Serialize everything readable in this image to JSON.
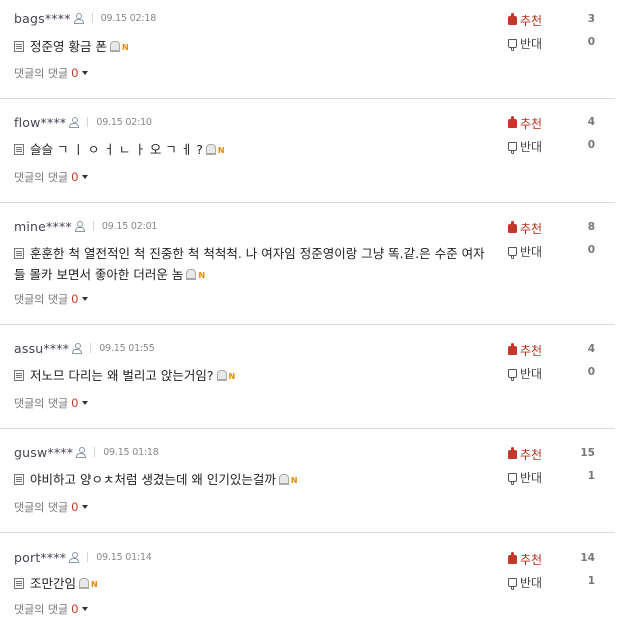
{
  "labels": {
    "reply_of_reply": "댓글의 댓글",
    "recommend": "추천",
    "oppose": "반대"
  },
  "comments": [
    {
      "author": "bags****",
      "time": "09.15 02:18",
      "text": "정준영 황금 폰",
      "replies": "0",
      "up": "3",
      "down": "0"
    },
    {
      "author": "flow****",
      "time": "09.15 02:10",
      "text": "슬슬 ㄱ ㅣ ㅇ ㅓ ㄴ ㅏ 오 ㄱ ㅔ ?",
      "replies": "0",
      "up": "4",
      "down": "0"
    },
    {
      "author": "mine****",
      "time": "09.15 02:01",
      "text": "훈훈한 척 열전적인 척 진중한 척 척척척. 나 여자임 정준영이랑 그냥 똑.같.은 수준 여자들 몰카 보면서 좋아한 더러운 놈",
      "replies": "0",
      "up": "8",
      "down": "0"
    },
    {
      "author": "assu****",
      "time": "09.15 01:55",
      "text": "저노므 다리는 왜 벌리고 앉는거임?",
      "replies": "0",
      "up": "4",
      "down": "0"
    },
    {
      "author": "gusw****",
      "time": "09.15 01:18",
      "text": "야비하고 양ㅇㅊ처럼 생겼는데 왜 인기있는걸까",
      "replies": "0",
      "up": "15",
      "down": "1"
    },
    {
      "author": "port****",
      "time": "09.15 01:14",
      "text": "조만간임",
      "replies": "0",
      "up": "14",
      "down": "1"
    }
  ]
}
